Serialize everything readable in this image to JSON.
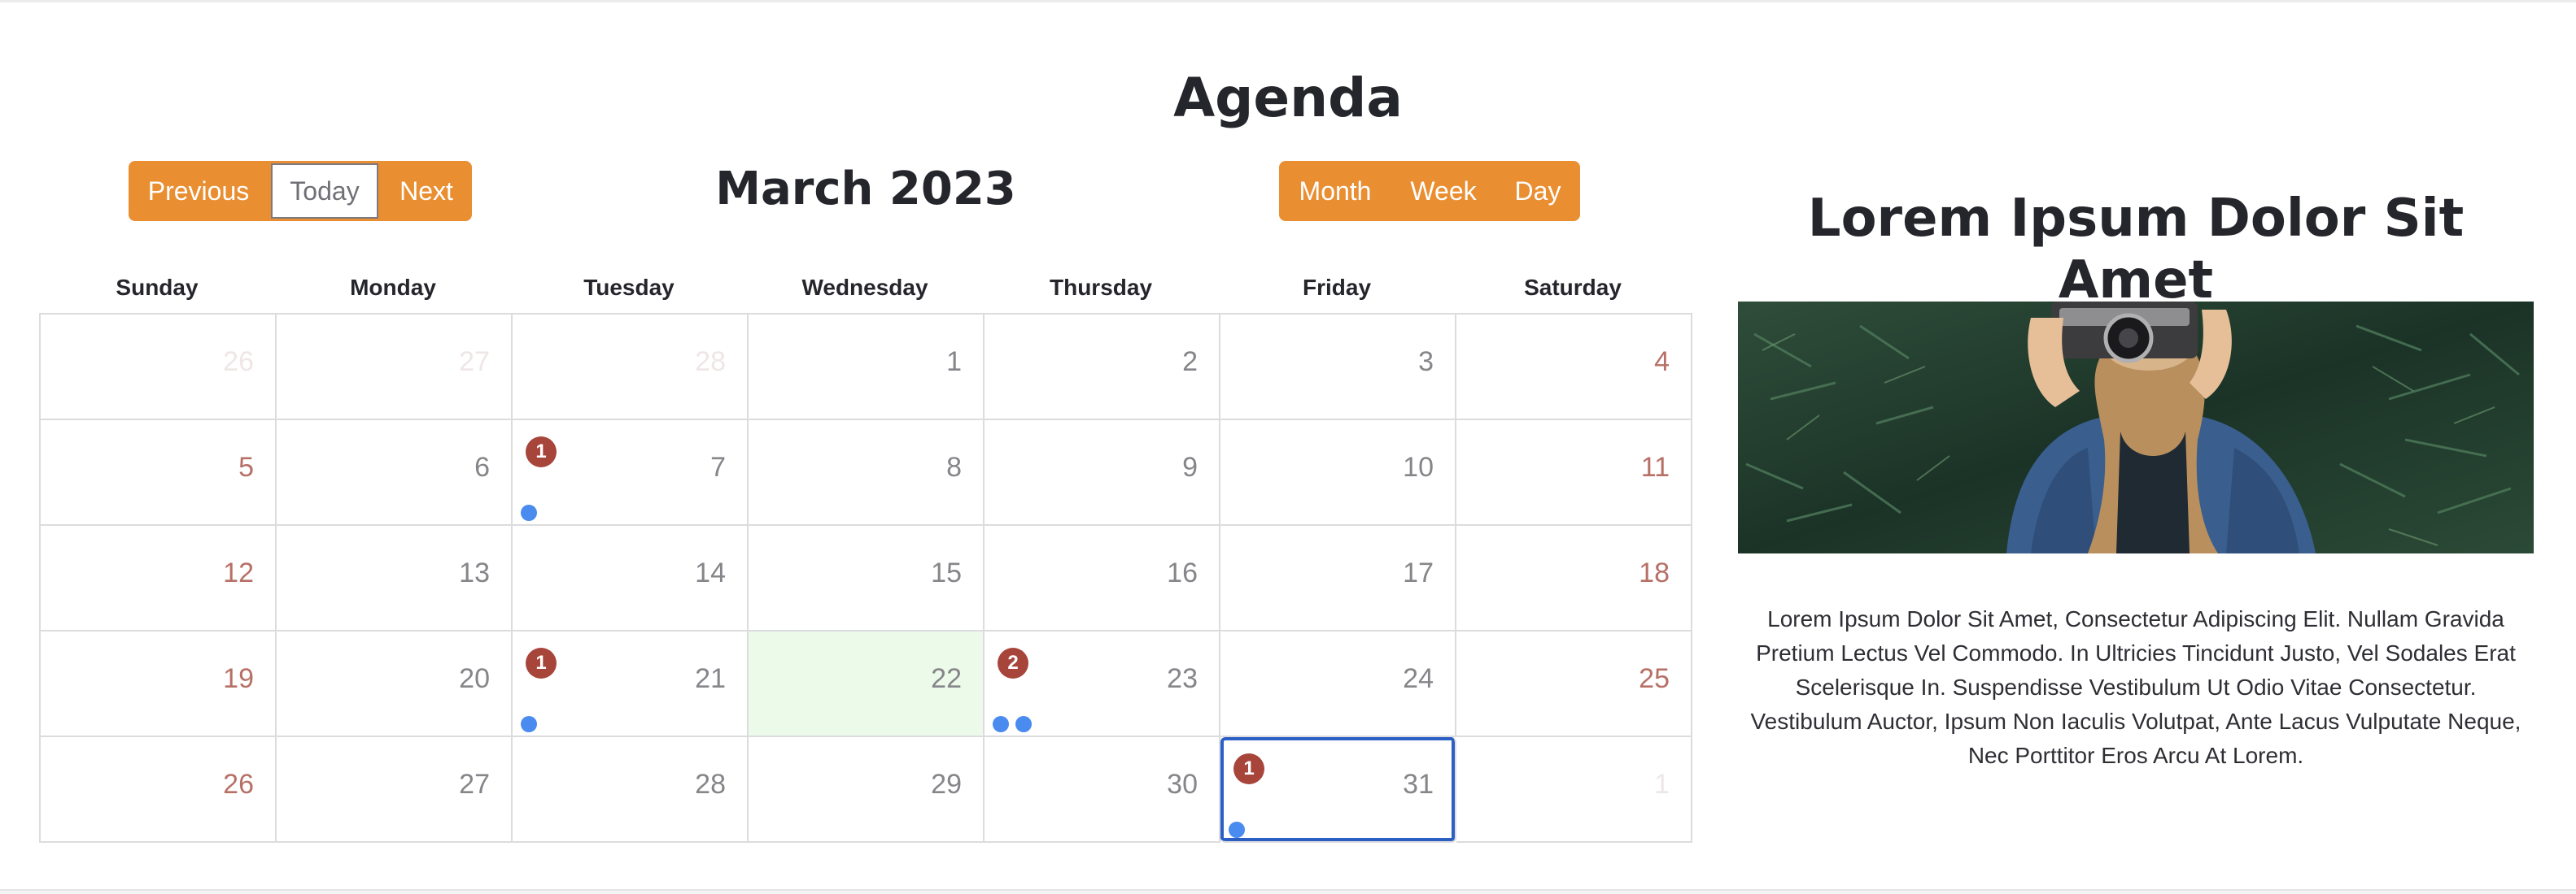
{
  "page": {
    "title": "Agenda"
  },
  "toolbar": {
    "previous_label": "Previous",
    "today_label": "Today",
    "next_label": "Next",
    "month_title": "March 2023",
    "views": {
      "month": "Month",
      "week": "Week",
      "day": "Day"
    }
  },
  "calendar": {
    "weekdays": [
      "Sunday",
      "Monday",
      "Tuesday",
      "Wednesday",
      "Thursday",
      "Friday",
      "Saturday"
    ],
    "weeks": [
      [
        {
          "day": "26",
          "other": true
        },
        {
          "day": "27",
          "other": true
        },
        {
          "day": "28",
          "other": true
        },
        {
          "day": "1"
        },
        {
          "day": "2"
        },
        {
          "day": "3"
        },
        {
          "day": "4"
        }
      ],
      [
        {
          "day": "5"
        },
        {
          "day": "6"
        },
        {
          "day": "7",
          "badge": "1",
          "dots": 1
        },
        {
          "day": "8"
        },
        {
          "day": "9"
        },
        {
          "day": "10"
        },
        {
          "day": "11"
        }
      ],
      [
        {
          "day": "12"
        },
        {
          "day": "13"
        },
        {
          "day": "14"
        },
        {
          "day": "15"
        },
        {
          "day": "16"
        },
        {
          "day": "17"
        },
        {
          "day": "18"
        }
      ],
      [
        {
          "day": "19"
        },
        {
          "day": "20"
        },
        {
          "day": "21",
          "badge": "1",
          "dots": 1
        },
        {
          "day": "22",
          "highlight": true
        },
        {
          "day": "23",
          "badge": "2",
          "dots": 2
        },
        {
          "day": "24"
        },
        {
          "day": "25"
        }
      ],
      [
        {
          "day": "26"
        },
        {
          "day": "27"
        },
        {
          "day": "28"
        },
        {
          "day": "29"
        },
        {
          "day": "30"
        },
        {
          "day": "31",
          "badge": "1",
          "dots": 1,
          "selected": true
        },
        {
          "day": "1",
          "other": true
        }
      ]
    ]
  },
  "sidebar": {
    "title": "Lorem Ipsum Dolor Sit Amet",
    "text": "Lorem Ipsum Dolor Sit Amet, Consectetur Adipiscing Elit. Nullam Gravida Pretium Lectus Vel Commodo. In Ultricies Tincidunt Justo, Vel Sodales Erat Scelerisque In. Suspendisse Vestibulum Ut Odio Vitae Consectetur. Vestibulum Auctor, Ipsum Non Iaculis Volutpat, Ante Lacus Vulputate Neque, Nec Porttitor Eros Arcu At Lorem."
  },
  "colors": {
    "accent": "#e98e31",
    "badge": "#a8453b",
    "dot": "#4a8bef",
    "weekend": "#b77066",
    "today_highlight": "#ecfaea",
    "selected_outline": "#2b5fc4"
  }
}
